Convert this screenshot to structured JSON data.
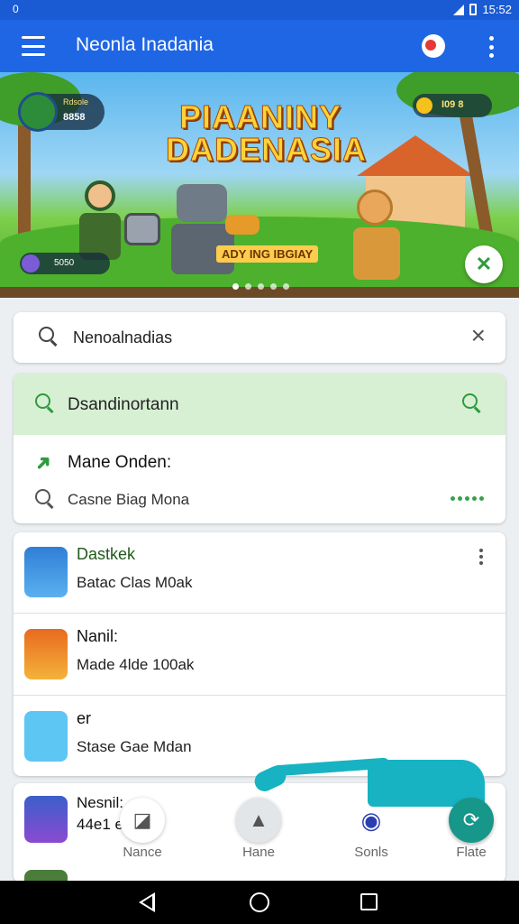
{
  "status_bar": {
    "left": "0",
    "time": "15:52"
  },
  "app_bar": {
    "title": "Neonla Inadania"
  },
  "banner": {
    "title_line1": "PIAANINY",
    "title_line2": "DADENASIA",
    "subtitle": "ADY ING IBGIAY",
    "avatar_label": "Rdsole",
    "avatar_value": "8858",
    "coin_value": "I09 8",
    "hp_value": "5050",
    "carousel_dots": 5,
    "active_dot": 0
  },
  "search": {
    "value": "Nenoalnadias",
    "clear_icon": "close-icon"
  },
  "suggestions": {
    "header": "Dsandinortann",
    "item1": "Mane Onden:",
    "item2": "Casne Biag Mona"
  },
  "games": [
    {
      "name": "Dastkek",
      "desc": "Batac Clas M0ak"
    },
    {
      "name": "Nanil:",
      "desc": "Made 4lde 100ak"
    },
    {
      "name": "er",
      "desc": "Stase Gae Mdan"
    }
  ],
  "game4": {
    "name": "Nesnil:",
    "desc": "44e1 e"
  },
  "bottom_nav": [
    {
      "label": "Nance",
      "icon": "tag-icon"
    },
    {
      "label": "Hane",
      "icon": "home-icon"
    },
    {
      "label": "Sonls",
      "icon": "record-icon"
    },
    {
      "label": "Flate",
      "icon": "refresh-icon"
    }
  ],
  "colors": {
    "app_bar": "#1f66e5",
    "accent_green": "#2e9b3d",
    "suggest_bg": "#d7f0d4",
    "teal": "#17b3c2"
  }
}
